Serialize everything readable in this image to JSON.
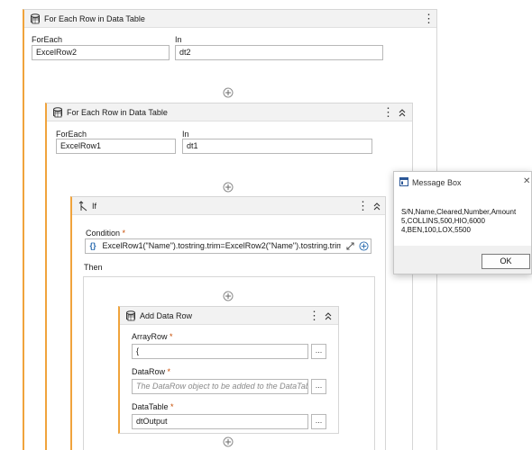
{
  "outer": {
    "title": "For Each Row in Data Table",
    "foreach_label": "ForEach",
    "foreach_value": "ExcelRow2",
    "in_label": "In",
    "in_value": "dt2"
  },
  "inner": {
    "title": "For Each Row in Data Table",
    "foreach_label": "ForEach",
    "foreach_value": "ExcelRow1",
    "in_label": "In",
    "in_value": "dt1"
  },
  "if_block": {
    "title": "If",
    "condition_label": "Condition",
    "required_mark": "*",
    "expr_badge": "{}",
    "condition_value": "ExcelRow1(\"Name\").tostring.trim=ExcelRow2(\"Name\").tostring.trim",
    "then_label": "Then"
  },
  "add_data_row": {
    "title": "Add Data Row",
    "arrayrow_label": "ArrayRow",
    "arrayrow_value": "{",
    "datarow_label": "DataRow",
    "datarow_placeholder": "The DataRow object to be added to the DataTabl",
    "datatable_label": "DataTable",
    "datatable_value": "dtOutput",
    "browse_label": "..."
  },
  "message_box": {
    "title": "Message Box",
    "close_glyph": "✕",
    "lines": [
      "S/N,Name,Cleared,Number,Amount",
      "5,COLLINS,500,HIO,6000",
      "4,BEN,100,LOX,5500"
    ],
    "ok_label": "OK"
  },
  "icons": {
    "kebab": "⋮"
  },
  "colors": {
    "accent_border": "#f0a33c",
    "header_bg": "#f2f2f2",
    "required": "#c74b00",
    "expr_badge": "#2b6cb0"
  }
}
